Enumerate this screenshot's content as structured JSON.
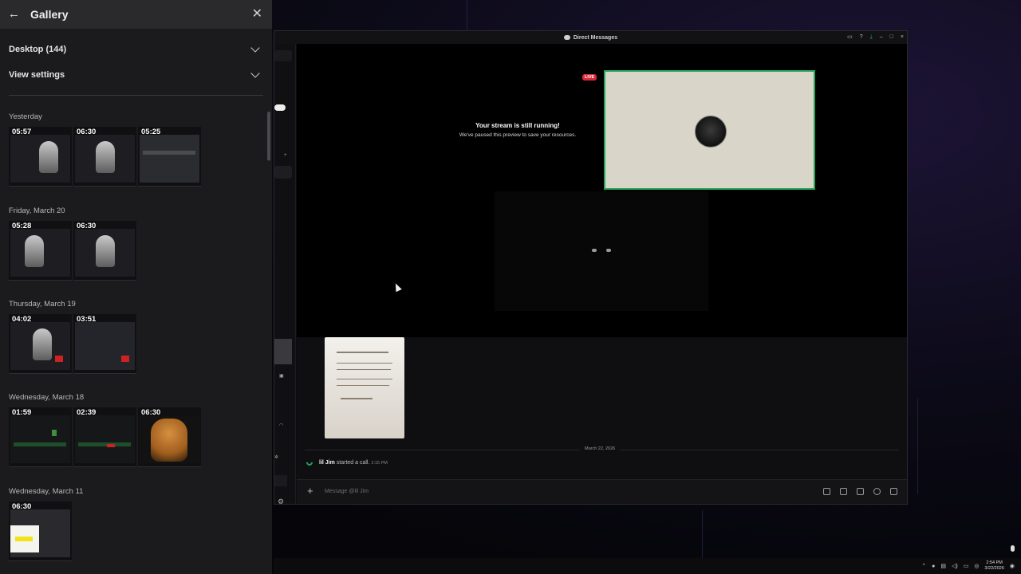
{
  "gallery": {
    "title": "Gallery",
    "sections": [
      {
        "label": "Desktop (144)"
      },
      {
        "label": "View settings"
      }
    ],
    "groups": [
      {
        "date": "Yesterday",
        "durations": [
          "05:57",
          "06:30",
          "05:25"
        ]
      },
      {
        "date": "Friday, March 20",
        "durations": [
          "05:28",
          "06:30"
        ]
      },
      {
        "date": "Thursday, March 19",
        "durations": [
          "04:02",
          "03:51"
        ]
      },
      {
        "date": "Wednesday, March 18",
        "durations": [
          "01:59",
          "02:39",
          "06:30"
        ]
      },
      {
        "date": "Wednesday, March 11",
        "durations": [
          "06:30"
        ]
      }
    ]
  },
  "discord": {
    "window_title": "Direct Messages",
    "live_badge": "LIVE",
    "stream_paused_title": "Your stream is still running!",
    "stream_paused_subtitle": "We've paused this preview to save your resources.",
    "date_divider": "March 22, 2026",
    "call_message": {
      "user": "lil Jim",
      "text": "started a call.",
      "time": "2:15 PM"
    },
    "composer_placeholder": "Message @lil Jim",
    "accent_green": "#23a55a",
    "live_red": "#d8283a"
  },
  "taskbar": {
    "time": "2:54 PM",
    "date": "3/22/2026"
  }
}
